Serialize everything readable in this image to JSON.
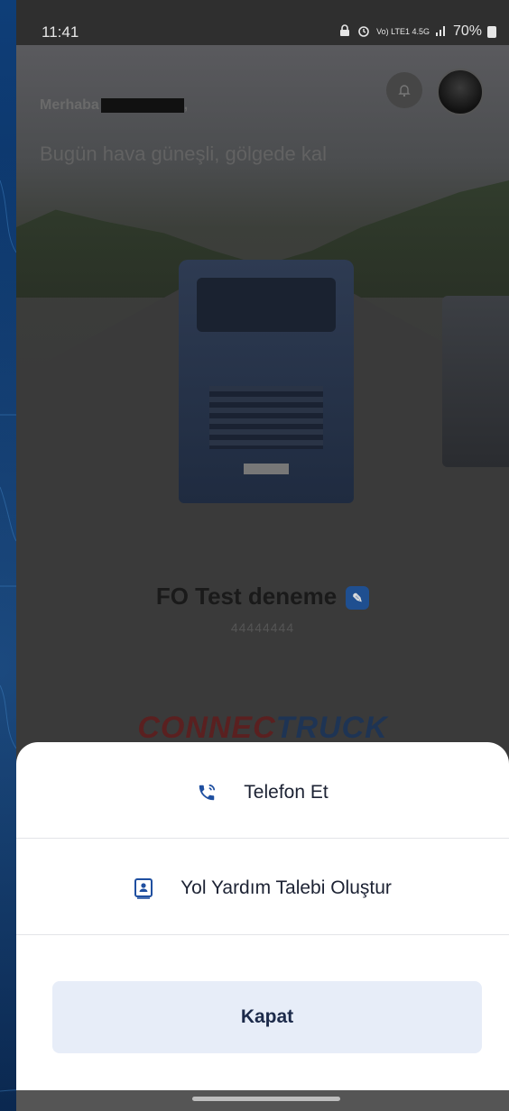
{
  "status_bar": {
    "time": "11:41",
    "network": "Vo) LTE1 4.5G",
    "battery": "70%"
  },
  "home": {
    "greeting": "Merhaba",
    "weather_message": "Bugün hava güneşli, gölgede kal",
    "truck_name": "FO Test deneme",
    "truck_plate": "44444444",
    "brand_part1": "CONNEC",
    "brand_part2": "TRUCK"
  },
  "sheet": {
    "call_label": "Telefon Et",
    "roadside_label": "Yol Yardım Talebi Oluştur",
    "close_label": "Kapat"
  },
  "colors": {
    "accent_blue": "#1f4fa0",
    "close_button_bg": "#e7edf8",
    "sheet_bg": "#ffffff"
  }
}
